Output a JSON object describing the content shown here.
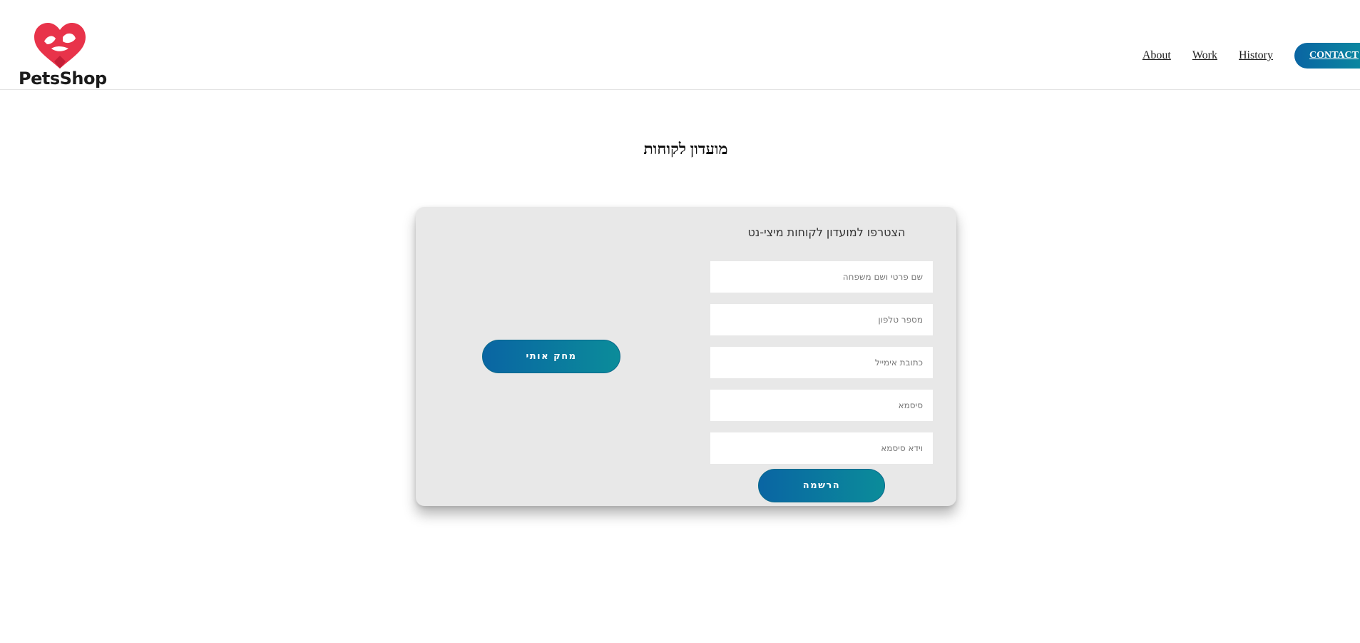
{
  "header": {
    "logo_text": "PetsShop",
    "nav": [
      {
        "label": "About"
      },
      {
        "label": "Work"
      },
      {
        "label": "History"
      }
    ],
    "contact_label": "CONTACT"
  },
  "page": {
    "title": "מועדון לקוחות"
  },
  "card": {
    "heading": "הצטרפו למועדון לקוחות מיצי-נט",
    "fields": {
      "full_name": "שם פרטי ושם משפחה",
      "phone": "מספר טלפון",
      "email": "כתובת אימייל",
      "password": "סיסמא",
      "confirm_password": "וידא סיסמא"
    },
    "delete_label": "מחק אותי",
    "register_label": "הרשמה"
  },
  "colors": {
    "accent_start": "#0a65a3",
    "accent_end": "#0b8c9a",
    "logo_heart": "#e8334a",
    "card_bg": "#e8e8e8"
  },
  "icons": {
    "logo": "heart-with-pets-logo-icon"
  }
}
